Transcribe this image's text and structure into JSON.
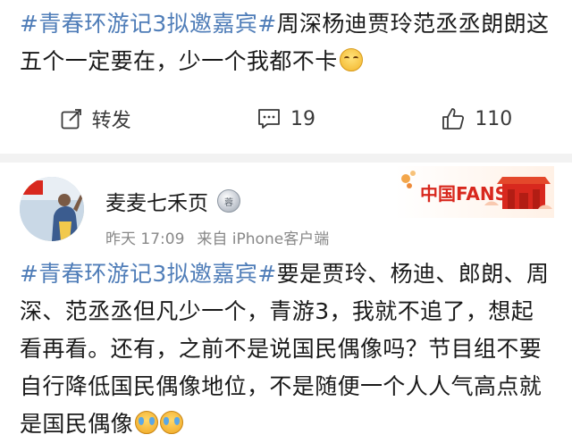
{
  "post1": {
    "topic": "#青春环游记3拟邀嘉宾#",
    "text": "周深杨迪贾玲范丞丞朗朗这五个一定要在，少一个我都不卡",
    "emoji": "giggle-emoji",
    "actions": {
      "repost_label": "转发",
      "comments_count": "19",
      "likes_count": "110"
    }
  },
  "post2": {
    "author": "麦麦七禾页",
    "time": "昨天 17:09",
    "source": "来自 iPhone客户端",
    "badge_text": "中国FANS",
    "topic": "#青春环游记3拟邀嘉宾#",
    "text": "要是贾玲、杨迪、郎朗、周深、范丞丞但凡少一个，青游3，我就不追了，想起看再看。还有，之前不是说国民偶像吗？节目组不要自行降低国民偶像地位，不是随便一个人人气高点就是国民偶像",
    "emojis": [
      "cry-emoji",
      "cry-emoji"
    ]
  },
  "colors": {
    "topic": "#4f7db8",
    "text": "#1a1a1a",
    "meta": "#888888",
    "separator": "#f2f2f2",
    "flag_red": "#d8281e",
    "flag_yellow": "#ffd400"
  }
}
